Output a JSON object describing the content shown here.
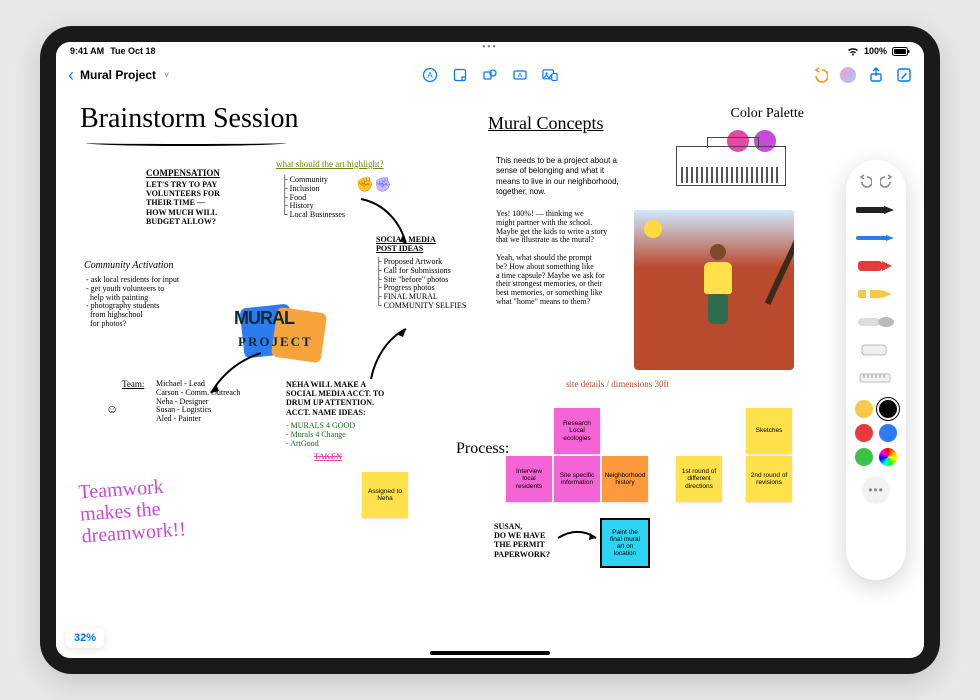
{
  "status": {
    "time": "9:41 AM",
    "date": "Tue Oct 18",
    "battery": "100%"
  },
  "toolbar": {
    "doc_title": "Mural Project",
    "back_label": "‹",
    "chevron": "˅"
  },
  "zoom": "32%",
  "canvas": {
    "title_main": "Brainstorm Session",
    "title_concepts": "Mural Concepts",
    "color_palette_label": "Color Palette",
    "compensation": {
      "title": "COMPENSATION",
      "body": "LET'S TRY TO PAY\nVOLUNTEERS FOR\nTHEIR TIME —\nHOW MUCH WILL\nBUDGET ALLOW?"
    },
    "highlight": {
      "title": "what should the art highlight?",
      "items": [
        "Community",
        "Inclusion",
        "Food",
        "History",
        "Local Businesses"
      ]
    },
    "social": {
      "title": "SOCIAL MEDIA\nPOST IDEAS",
      "items": [
        "Proposed Artwork",
        "Call for Submissions",
        "Site \"before\" photos",
        "Progress photos",
        "FINAL MURAL",
        "COMMUNITY SELFIES"
      ]
    },
    "community": {
      "title": "Community Activation",
      "body": "- ask local residents for input\n- get youth volunteers to\n  help with painting\n- photography students\n  from highschool\n  for photos?"
    },
    "team": {
      "title": "Team:",
      "body": "Michael - Lead\nCarson - Comm. Outreach\nNeha - Designer\nSusan - Logistics\nAled - Painter"
    },
    "neha": {
      "body": "NEHA WILL MAKE A\nSOCIAL MEDIA ACCT. TO\nDRUM UP ATTENTION.\nACCT. NAME IDEAS:",
      "ideas": "- MURALS 4 GOOD\n- Murals 4 Change\n- ArtGood",
      "taken": "TAKEN"
    },
    "teamwork": "Teamwork\nmakes the\ndreamwork!!",
    "typed_note": "This needs to be a project about a\nsense of belonging and what it\nmeans to live in our neighborhood,\ntogether, now.",
    "prompt_note": "Yes! 100%! — thinking we\nmight partner with the school.\nMaybe get the kids to write a story\nthat we illustrate as the mural?\n\nYeah, what should the prompt\nbe? How about something like\na time capsule? Maybe we ask for\ntheir strongest memories, or their\nbest memories, or something like\nwhat \"home\" means to them?",
    "site_note": "site details / dimensions 30ft",
    "process_label": "Process:",
    "susan_note": "SUSAN,\nDO WE HAVE\nTHE PERMIT\nPAPERWORK?",
    "mural_logo": {
      "line1": "MURAL",
      "line2": "PROJECT"
    }
  },
  "stickies": {
    "assigned": "Assigned to\nNeha",
    "research": "Research Local\necologies",
    "sketches": "Sketches",
    "interview": "Interview\nlocal residents",
    "site_info": "Site specific\ninformation",
    "hood": "Neighborhood\nhistory",
    "round1": "1st round of\ndifferent\ndirections",
    "round2": "2nd round\nof revisions",
    "paint": "Paint the final\nmural art on\nlocation"
  },
  "palette_swatches": [
    "#E64AA9",
    "#C74ADB"
  ],
  "tools": {
    "colors": [
      "#F7C948",
      "#000000",
      "#E83A3A",
      "#2A7CEF",
      "#3CC24A"
    ],
    "selected": 1
  }
}
